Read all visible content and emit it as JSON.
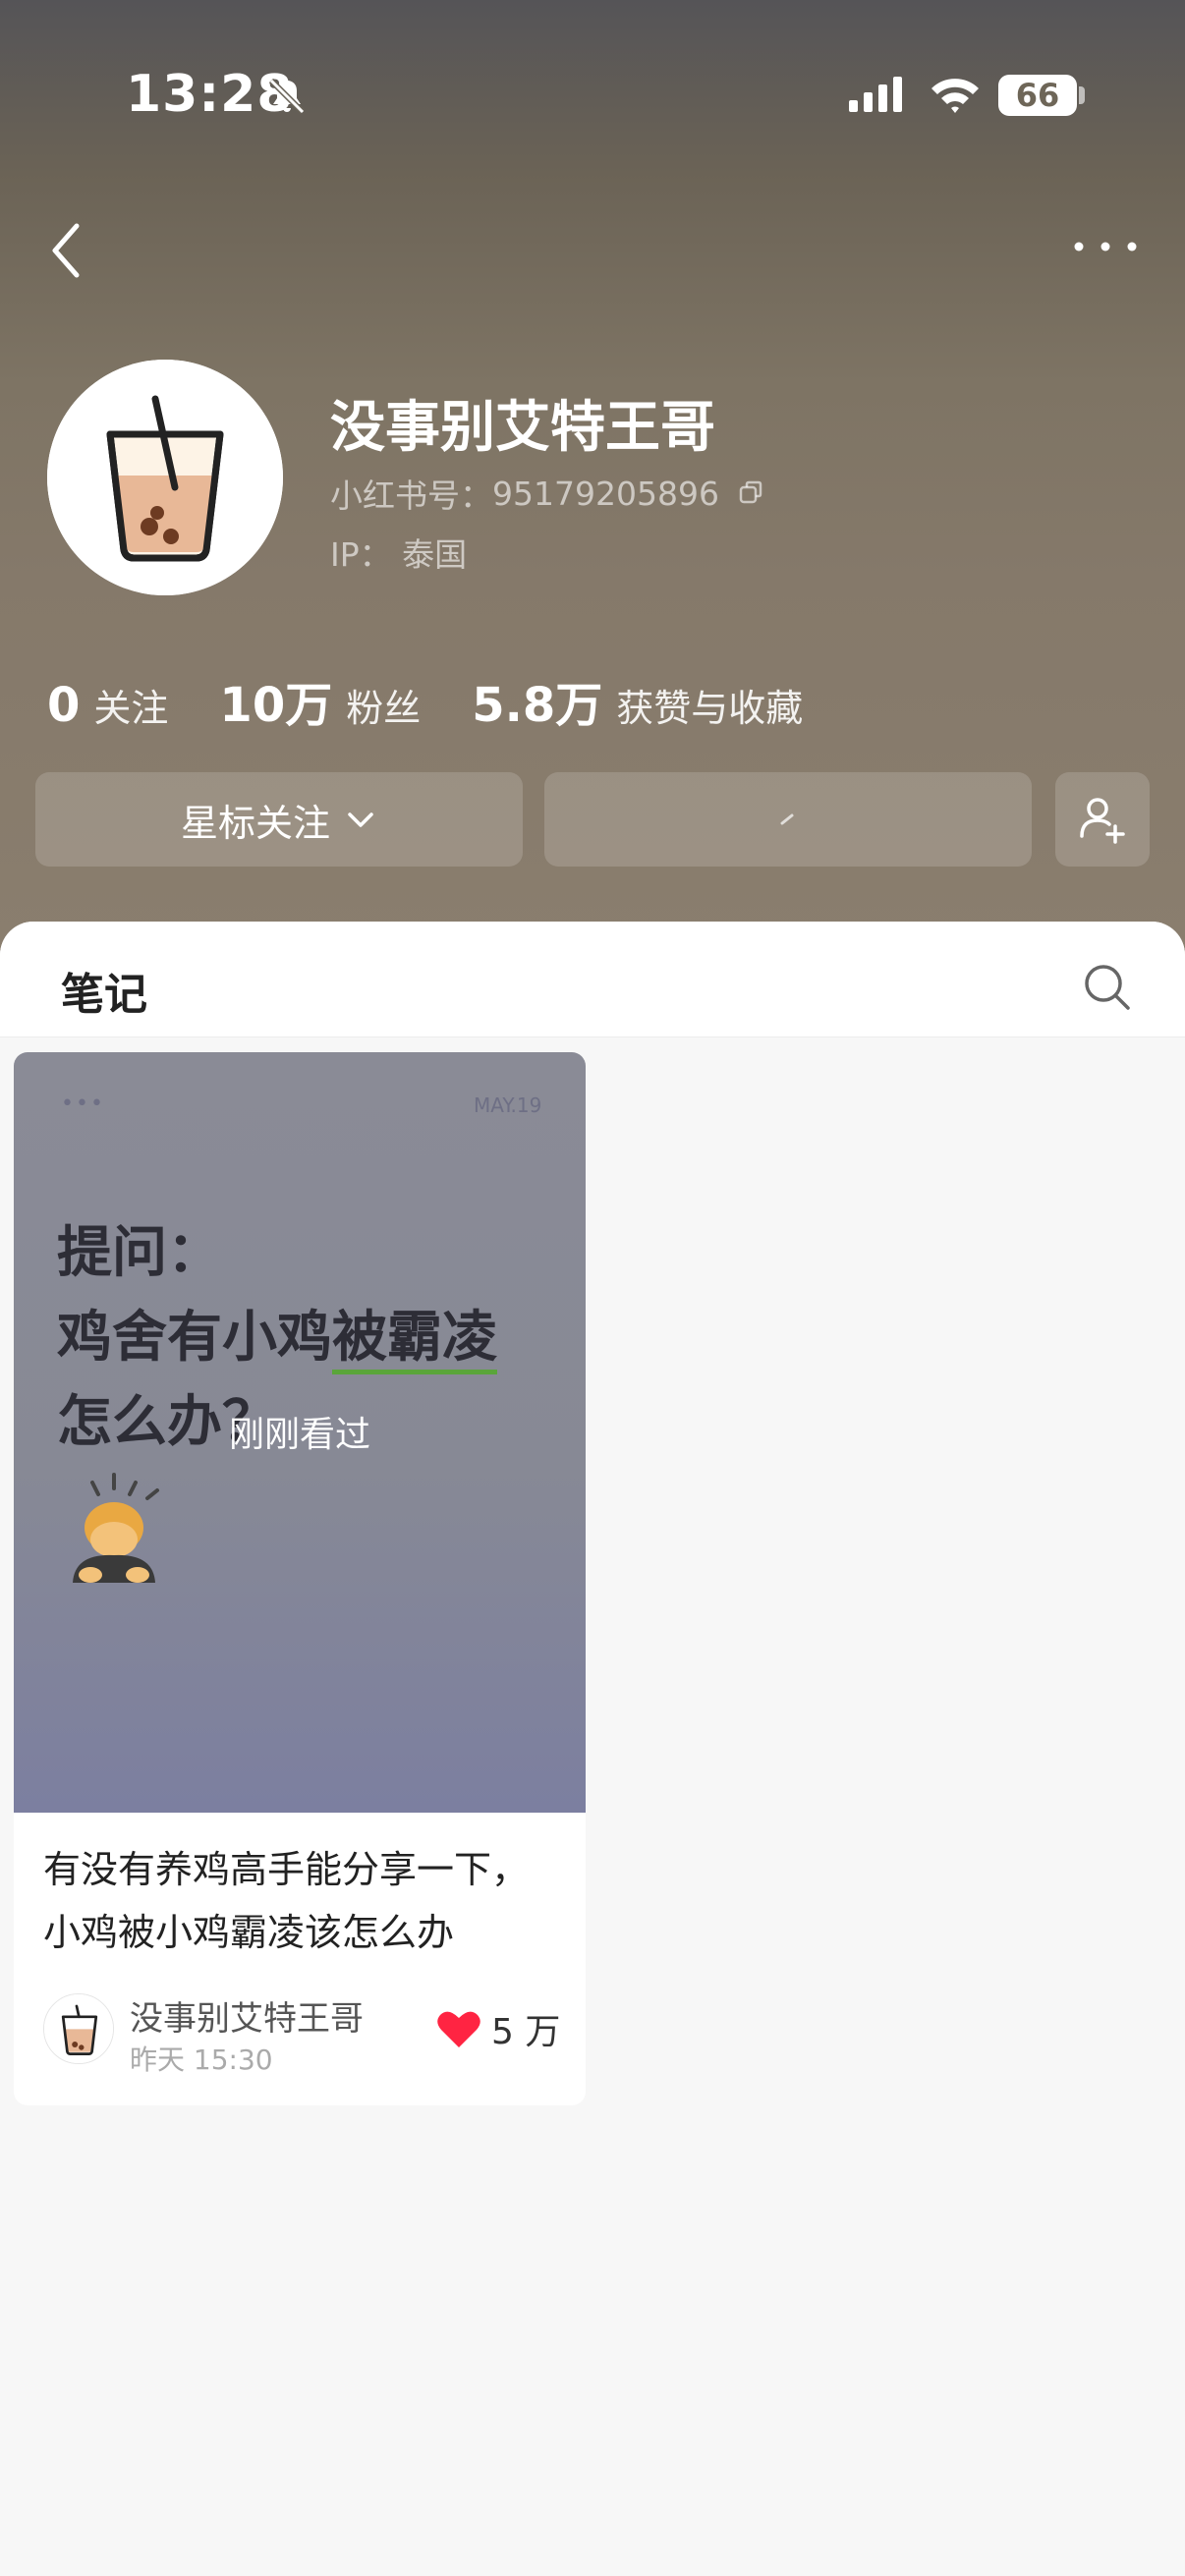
{
  "status_bar": {
    "time": "13:28",
    "battery": "66"
  },
  "profile": {
    "nickname": "没事别艾特王哥",
    "id_label": "小红书号：",
    "id_value": "95179205896",
    "ip_label": "IP：",
    "ip_value": "泰国"
  },
  "stats": [
    {
      "num": "0",
      "label": "关注"
    },
    {
      "num": "10万",
      "label": "粉丝"
    },
    {
      "num": "5.8万",
      "label": "获赞与收藏"
    }
  ],
  "actions": {
    "star_follow": "星标关注"
  },
  "tabs": {
    "notes": "笔记"
  },
  "notes": [
    {
      "cover_dots": "•••",
      "cover_date": "MAY.19",
      "cover_line1": "提问：",
      "cover_line2a": "鸡舍有小鸡",
      "cover_line2b": "被霸凌",
      "cover_line3": "怎么办？",
      "badge": "刚刚看过",
      "title": "有没有养鸡高手能分享一下，小鸡被小鸡霸凌该怎么办",
      "author": "没事别艾特王哥",
      "time": "昨天 15:30",
      "likes": "5 万"
    }
  ],
  "colors": {
    "like_heart": "#ff2442",
    "header_top": "#555457",
    "header_bottom": "#8a7e6e"
  }
}
